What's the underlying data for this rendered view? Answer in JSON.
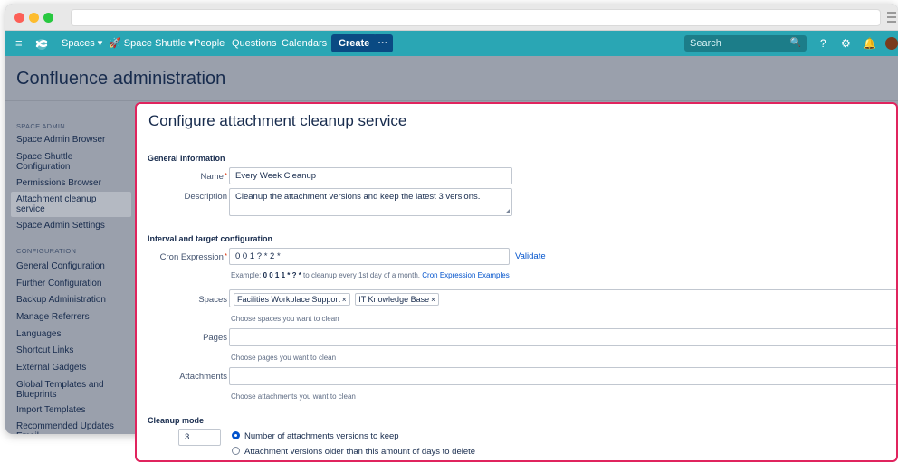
{
  "navbar": {
    "menu_icon": "≡",
    "spaces": "Spaces ▾",
    "shuttle": "🚀 Space Shuttle ▾",
    "people": "People",
    "questions": "Questions",
    "calendars": "Calendars",
    "create": "Create",
    "more": "···",
    "search_placeholder": "Search",
    "search_icon": "🔍",
    "help_icon": "?",
    "gear_icon": "⚙",
    "bell_icon": "🔔"
  },
  "page": {
    "title": "Confluence administration"
  },
  "sidebar": {
    "section1": "SPACE ADMIN",
    "items1": [
      "Space Admin Browser",
      "Space Shuttle Configuration",
      "Permissions Browser",
      "Attachment cleanup service",
      "Space Admin Settings"
    ],
    "section2": "CONFIGURATION",
    "items2": [
      "General Configuration",
      "Further Configuration",
      "Backup Administration",
      "Manage Referrers",
      "Languages",
      "Shortcut Links",
      "External Gadgets",
      "Global Templates and Blueprints",
      "Import Templates",
      "Recommended Updates Email"
    ]
  },
  "form": {
    "title": "Configure attachment cleanup service",
    "general_section": "General Information",
    "name_label": "Name",
    "name_value": "Every Week Cleanup",
    "desc_label": "Description",
    "desc_value": "Cleanup the attachment versions and keep the latest 3 versions.",
    "interval_section": "Interval and target configuration",
    "cron_label": "Cron Expression",
    "cron_value": "0 0 1 ? * 2 *",
    "validate": "Validate",
    "cron_hint_prefix": "Example: ",
    "cron_hint_example": "0 0 1 1 * ? *",
    "cron_hint_suffix": " to cleanup every 1st day of a month. ",
    "cron_hint_link": "Cron Expression Examples",
    "spaces_label": "Spaces",
    "space_tags": [
      "Facilities Workplace Support",
      "IT Knowledge Base"
    ],
    "tag_remove": "×",
    "spaces_hint": "Choose spaces you want to clean",
    "pages_label": "Pages",
    "pages_hint": "Choose pages you want to clean",
    "attachments_label": "Attachments",
    "attachments_hint": "Choose attachments you want to clean",
    "cleanup_section": "Cleanup mode",
    "cleanup_value": "3",
    "option1": "Number of attachments versions to keep",
    "option2": "Attachment versions older than this amount of days to delete"
  },
  "colors": {
    "navbar": "#2aa6b4",
    "create": "#0a4a83",
    "highlight": "#e0245e",
    "link": "#0052cc"
  }
}
